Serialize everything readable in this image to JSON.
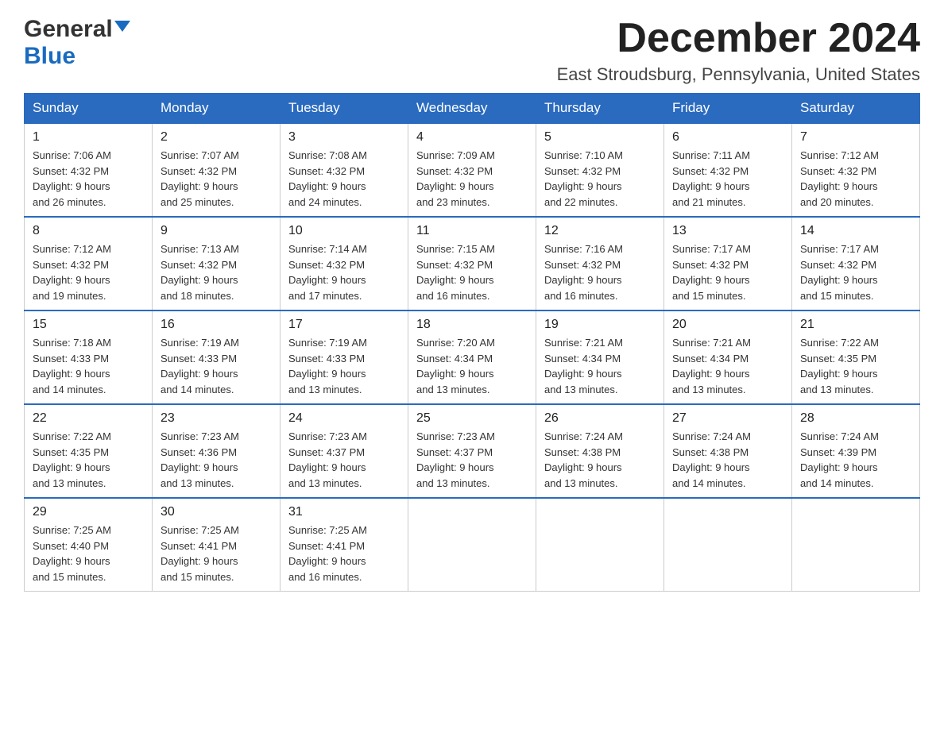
{
  "logo": {
    "general": "General",
    "blue": "Blue"
  },
  "title": "December 2024",
  "location": "East Stroudsburg, Pennsylvania, United States",
  "days_of_week": [
    "Sunday",
    "Monday",
    "Tuesday",
    "Wednesday",
    "Thursday",
    "Friday",
    "Saturday"
  ],
  "weeks": [
    [
      {
        "day": "1",
        "sunrise": "7:06 AM",
        "sunset": "4:32 PM",
        "daylight": "9 hours and 26 minutes."
      },
      {
        "day": "2",
        "sunrise": "7:07 AM",
        "sunset": "4:32 PM",
        "daylight": "9 hours and 25 minutes."
      },
      {
        "day": "3",
        "sunrise": "7:08 AM",
        "sunset": "4:32 PM",
        "daylight": "9 hours and 24 minutes."
      },
      {
        "day": "4",
        "sunrise": "7:09 AM",
        "sunset": "4:32 PM",
        "daylight": "9 hours and 23 minutes."
      },
      {
        "day": "5",
        "sunrise": "7:10 AM",
        "sunset": "4:32 PM",
        "daylight": "9 hours and 22 minutes."
      },
      {
        "day": "6",
        "sunrise": "7:11 AM",
        "sunset": "4:32 PM",
        "daylight": "9 hours and 21 minutes."
      },
      {
        "day": "7",
        "sunrise": "7:12 AM",
        "sunset": "4:32 PM",
        "daylight": "9 hours and 20 minutes."
      }
    ],
    [
      {
        "day": "8",
        "sunrise": "7:12 AM",
        "sunset": "4:32 PM",
        "daylight": "9 hours and 19 minutes."
      },
      {
        "day": "9",
        "sunrise": "7:13 AM",
        "sunset": "4:32 PM",
        "daylight": "9 hours and 18 minutes."
      },
      {
        "day": "10",
        "sunrise": "7:14 AM",
        "sunset": "4:32 PM",
        "daylight": "9 hours and 17 minutes."
      },
      {
        "day": "11",
        "sunrise": "7:15 AM",
        "sunset": "4:32 PM",
        "daylight": "9 hours and 16 minutes."
      },
      {
        "day": "12",
        "sunrise": "7:16 AM",
        "sunset": "4:32 PM",
        "daylight": "9 hours and 16 minutes."
      },
      {
        "day": "13",
        "sunrise": "7:17 AM",
        "sunset": "4:32 PM",
        "daylight": "9 hours and 15 minutes."
      },
      {
        "day": "14",
        "sunrise": "7:17 AM",
        "sunset": "4:32 PM",
        "daylight": "9 hours and 15 minutes."
      }
    ],
    [
      {
        "day": "15",
        "sunrise": "7:18 AM",
        "sunset": "4:33 PM",
        "daylight": "9 hours and 14 minutes."
      },
      {
        "day": "16",
        "sunrise": "7:19 AM",
        "sunset": "4:33 PM",
        "daylight": "9 hours and 14 minutes."
      },
      {
        "day": "17",
        "sunrise": "7:19 AM",
        "sunset": "4:33 PM",
        "daylight": "9 hours and 13 minutes."
      },
      {
        "day": "18",
        "sunrise": "7:20 AM",
        "sunset": "4:34 PM",
        "daylight": "9 hours and 13 minutes."
      },
      {
        "day": "19",
        "sunrise": "7:21 AM",
        "sunset": "4:34 PM",
        "daylight": "9 hours and 13 minutes."
      },
      {
        "day": "20",
        "sunrise": "7:21 AM",
        "sunset": "4:34 PM",
        "daylight": "9 hours and 13 minutes."
      },
      {
        "day": "21",
        "sunrise": "7:22 AM",
        "sunset": "4:35 PM",
        "daylight": "9 hours and 13 minutes."
      }
    ],
    [
      {
        "day": "22",
        "sunrise": "7:22 AM",
        "sunset": "4:35 PM",
        "daylight": "9 hours and 13 minutes."
      },
      {
        "day": "23",
        "sunrise": "7:23 AM",
        "sunset": "4:36 PM",
        "daylight": "9 hours and 13 minutes."
      },
      {
        "day": "24",
        "sunrise": "7:23 AM",
        "sunset": "4:37 PM",
        "daylight": "9 hours and 13 minutes."
      },
      {
        "day": "25",
        "sunrise": "7:23 AM",
        "sunset": "4:37 PM",
        "daylight": "9 hours and 13 minutes."
      },
      {
        "day": "26",
        "sunrise": "7:24 AM",
        "sunset": "4:38 PM",
        "daylight": "9 hours and 13 minutes."
      },
      {
        "day": "27",
        "sunrise": "7:24 AM",
        "sunset": "4:38 PM",
        "daylight": "9 hours and 14 minutes."
      },
      {
        "day": "28",
        "sunrise": "7:24 AM",
        "sunset": "4:39 PM",
        "daylight": "9 hours and 14 minutes."
      }
    ],
    [
      {
        "day": "29",
        "sunrise": "7:25 AM",
        "sunset": "4:40 PM",
        "daylight": "9 hours and 15 minutes."
      },
      {
        "day": "30",
        "sunrise": "7:25 AM",
        "sunset": "4:41 PM",
        "daylight": "9 hours and 15 minutes."
      },
      {
        "day": "31",
        "sunrise": "7:25 AM",
        "sunset": "4:41 PM",
        "daylight": "9 hours and 16 minutes."
      },
      null,
      null,
      null,
      null
    ]
  ],
  "labels": {
    "sunrise": "Sunrise:",
    "sunset": "Sunset:",
    "daylight": "Daylight:"
  }
}
